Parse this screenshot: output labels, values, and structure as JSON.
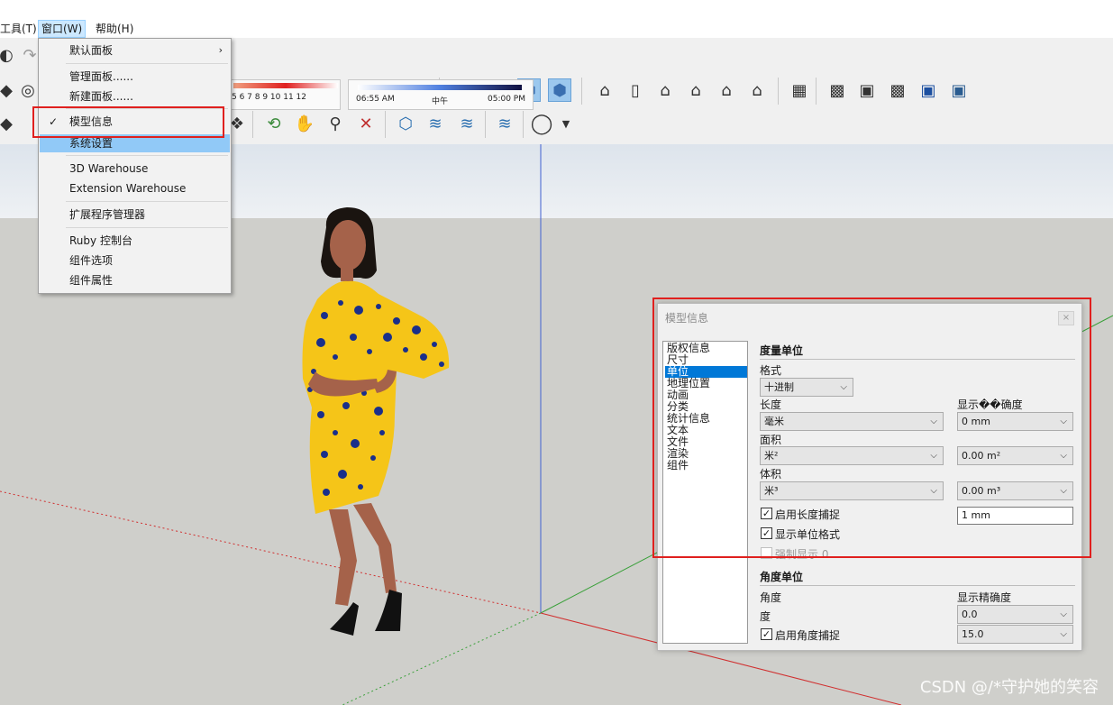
{
  "menubar": {
    "items": [
      "工具(T)",
      "窗口(W)",
      "帮助(H)"
    ]
  },
  "toolbar": {
    "shadow_months": "5  6  7  8  9  10 11 12",
    "time_start": "06:55 AM",
    "time_mid": "中午",
    "time_end": "05:00 PM",
    "shadow_month_progress": 0.9,
    "shadow_time_progress": 0.74
  },
  "window_menu": {
    "items": [
      {
        "label": "默认面板",
        "submenu": true
      },
      {
        "label": "管理面板......"
      },
      {
        "label": "新建面板......"
      },
      {
        "label": "模型信息",
        "checked": true
      },
      {
        "label": "系统设置",
        "hover": true
      },
      {
        "label": "3D Warehouse"
      },
      {
        "label": "Extension Warehouse"
      },
      {
        "label": "扩展程序管理器"
      },
      {
        "label": "Ruby 控制台"
      },
      {
        "label": "组件选项"
      },
      {
        "label": "组件属性"
      }
    ]
  },
  "dialog": {
    "title": "模型信息",
    "close_label": "×",
    "categories": [
      "版权信息",
      "尺寸",
      "单位",
      "地理位置",
      "动画",
      "分类",
      "统计信息",
      "文本",
      "文件",
      "渲染",
      "组件"
    ],
    "selected_category": "单位",
    "length_units": {
      "heading": "度量单位",
      "format_label": "格式",
      "format_value": "十进制",
      "length_label": "长度",
      "length_value": "毫米",
      "precision_label": "显示��确度",
      "length_precision": "0 mm",
      "area_label": "面积",
      "area_value": "米²",
      "area_precision": "0.00 m²",
      "volume_label": "体积",
      "volume_value": "米³",
      "volume_precision": "0.00 m³",
      "length_snap_label": "启用长度捕捉",
      "length_snap_checked": true,
      "length_snap_value": "1 mm",
      "show_unit_format_label": "显示单位格式",
      "show_unit_format_checked": true,
      "force_display_label": "强制显示 0",
      "force_display_checked": false
    },
    "angle_units": {
      "heading": "角度单位",
      "angle_label": "角度",
      "precision_label": "显示精确度",
      "angle_value": "度",
      "angle_precision": "0.0",
      "angle_snap_label": "启用角度捕捉",
      "angle_snap_checked": true,
      "angle_snap_value": "15.0"
    }
  },
  "watermark": "CSDN @/*守护她的笑容",
  "colors": {
    "highlight_red": "#e0201e",
    "selection_blue": "#0078d7",
    "menu_hover": "#91c9f7",
    "axis_red": "#d03030",
    "axis_green": "#3aa03a",
    "axis_blue": "#4060d0"
  }
}
